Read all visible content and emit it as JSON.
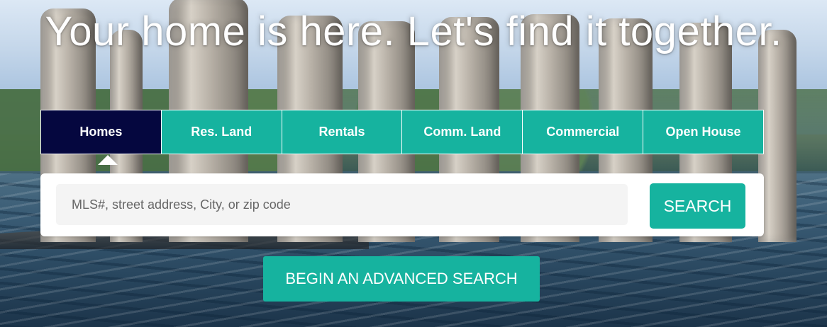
{
  "hero": {
    "headline": "Your home is here. Let's find it together.",
    "colors": {
      "teal": "#16b39f",
      "navy": "#05073f",
      "white": "#ffffff"
    }
  },
  "search": {
    "tabs": [
      {
        "label": "Homes",
        "active": true
      },
      {
        "label": "Res. Land",
        "active": false
      },
      {
        "label": "Rentals",
        "active": false
      },
      {
        "label": "Comm. Land",
        "active": false
      },
      {
        "label": "Commercial",
        "active": false
      },
      {
        "label": "Open House",
        "active": false
      }
    ],
    "placeholder": "MLS#, street address, City, or zip code",
    "value": "",
    "button_label": "SEARCH"
  },
  "advanced": {
    "button_label": "BEGIN AN ADVANCED SEARCH"
  },
  "background": {
    "scene": "bridge-pillars-over-water-photo"
  }
}
